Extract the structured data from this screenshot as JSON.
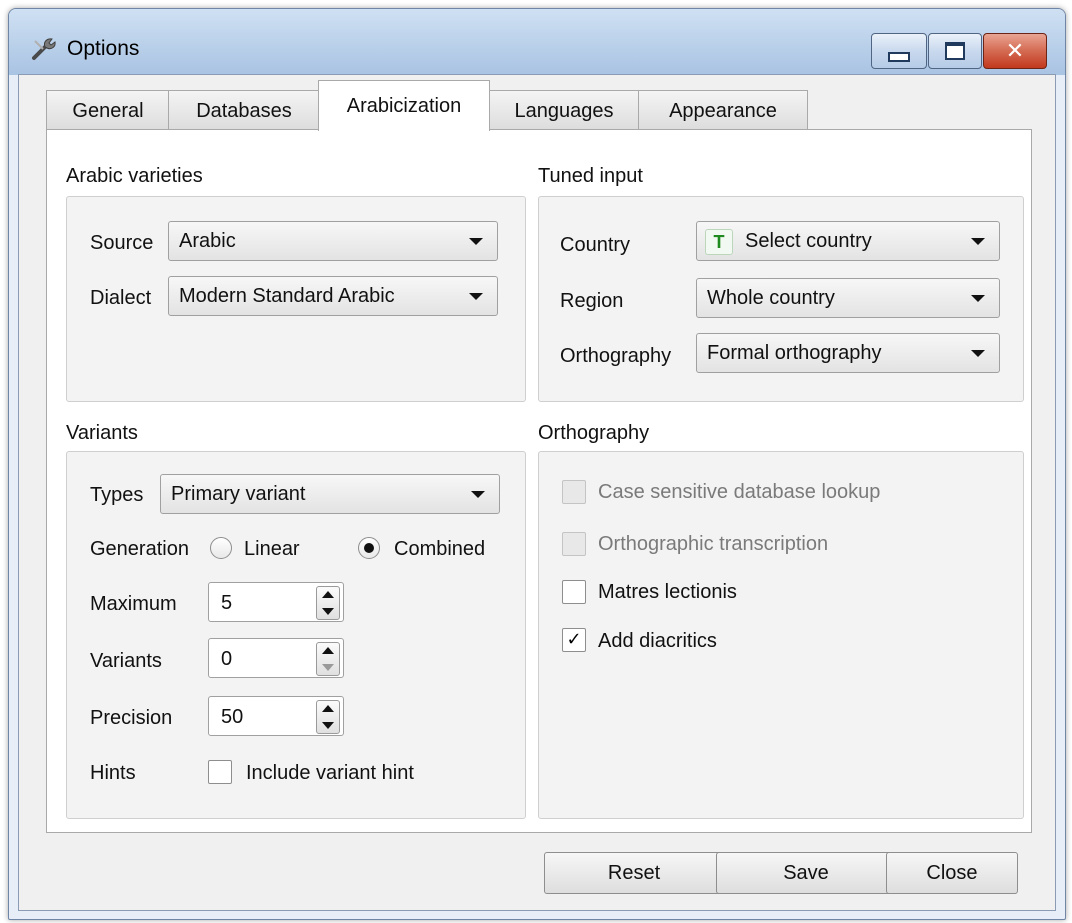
{
  "window": {
    "title": "Options"
  },
  "tabs": [
    {
      "label": "General"
    },
    {
      "label": "Databases"
    },
    {
      "label": "Arabicization"
    },
    {
      "label": "Languages"
    },
    {
      "label": "Appearance"
    }
  ],
  "arabic_varieties": {
    "title": "Arabic varieties",
    "source_label": "Source",
    "source_value": "Arabic",
    "dialect_label": "Dialect",
    "dialect_value": "Modern Standard Arabic"
  },
  "tuned_input": {
    "title": "Tuned input",
    "country_label": "Country",
    "country_icon_text": "T",
    "country_value": "Select country",
    "region_label": "Region",
    "region_value": "Whole country",
    "orthography_label": "Orthography",
    "orthography_value": "Formal orthography"
  },
  "variants": {
    "title": "Variants",
    "types_label": "Types",
    "types_value": "Primary variant",
    "generation_label": "Generation",
    "linear_label": "Linear",
    "combined_label": "Combined",
    "maximum_label": "Maximum",
    "maximum_value": "5",
    "variants_label": "Variants",
    "variants_value": "0",
    "precision_label": "Precision",
    "precision_value": "50",
    "hints_label": "Hints",
    "hint_checkbox_label": "Include variant hint"
  },
  "orthography": {
    "title": "Orthography",
    "case_sensitive_label": "Case sensitive database lookup",
    "orthographic_transcription_label": "Orthographic transcription",
    "matres_lectionis_label": "Matres lectionis",
    "add_diacritics_label": "Add diacritics",
    "check_mark": "✓"
  },
  "buttons": {
    "reset": "Reset",
    "save": "Save",
    "close": "Close"
  },
  "caption_buttons": {
    "close_glyph": "✕"
  }
}
